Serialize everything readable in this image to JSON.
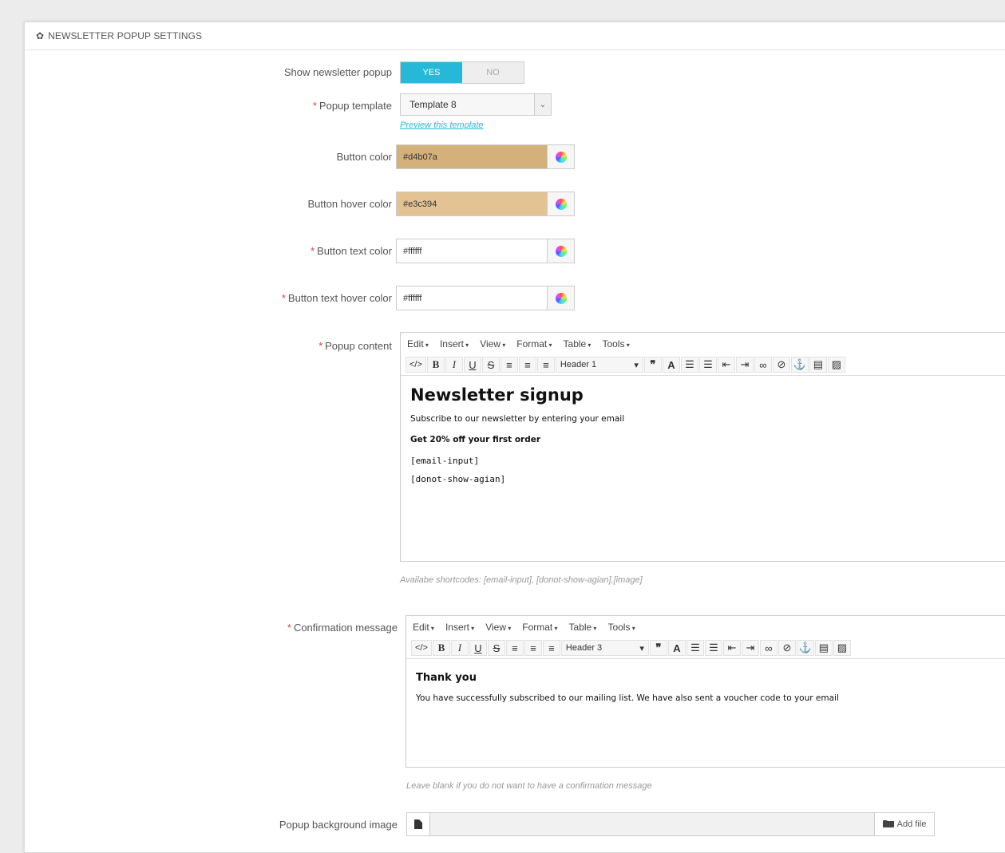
{
  "panel": {
    "title": "NEWSLETTER POPUP SETTINGS"
  },
  "fields": {
    "show_popup": {
      "label": "Show newsletter popup",
      "yes": "YES",
      "no": "NO"
    },
    "template": {
      "label": "Popup template",
      "value": "Template 8",
      "preview_link": "Preview this template"
    },
    "button_color": {
      "label": "Button color",
      "value": "#d4b07a"
    },
    "button_hover_color": {
      "label": "Button hover color",
      "value": "#e3c394"
    },
    "button_text_color": {
      "label": "Button text color",
      "value": "#ffffff"
    },
    "button_text_hover_color": {
      "label": "Button text hover color",
      "value": "#ffffff"
    },
    "popup_content": {
      "label": "Popup content",
      "menu": [
        "Edit",
        "Insert",
        "View",
        "Format",
        "Table",
        "Tools"
      ],
      "header_select": "Header 1",
      "heading": "Newsletter signup",
      "line1": "Subscribe to our newsletter by entering your email",
      "line2": "Get 20% off your first order",
      "line3": "[email-input]",
      "line4": "[donot-show-agian]",
      "hint": "Availabe shortcodes: [email-input], [donot-show-agian],[image]"
    },
    "confirmation": {
      "label": "Confirmation message",
      "menu": [
        "Edit",
        "Insert",
        "View",
        "Format",
        "Table",
        "Tools"
      ],
      "header_select": "Header 3",
      "heading": "Thank you",
      "line1": "You have successfully subscribed to our mailing list. We have also sent a voucher code to your email",
      "hint": "Leave blank if you do not want to have a confirmation message"
    },
    "bg_image": {
      "label": "Popup background image",
      "add_file": "Add file"
    }
  },
  "required_marker": "*"
}
